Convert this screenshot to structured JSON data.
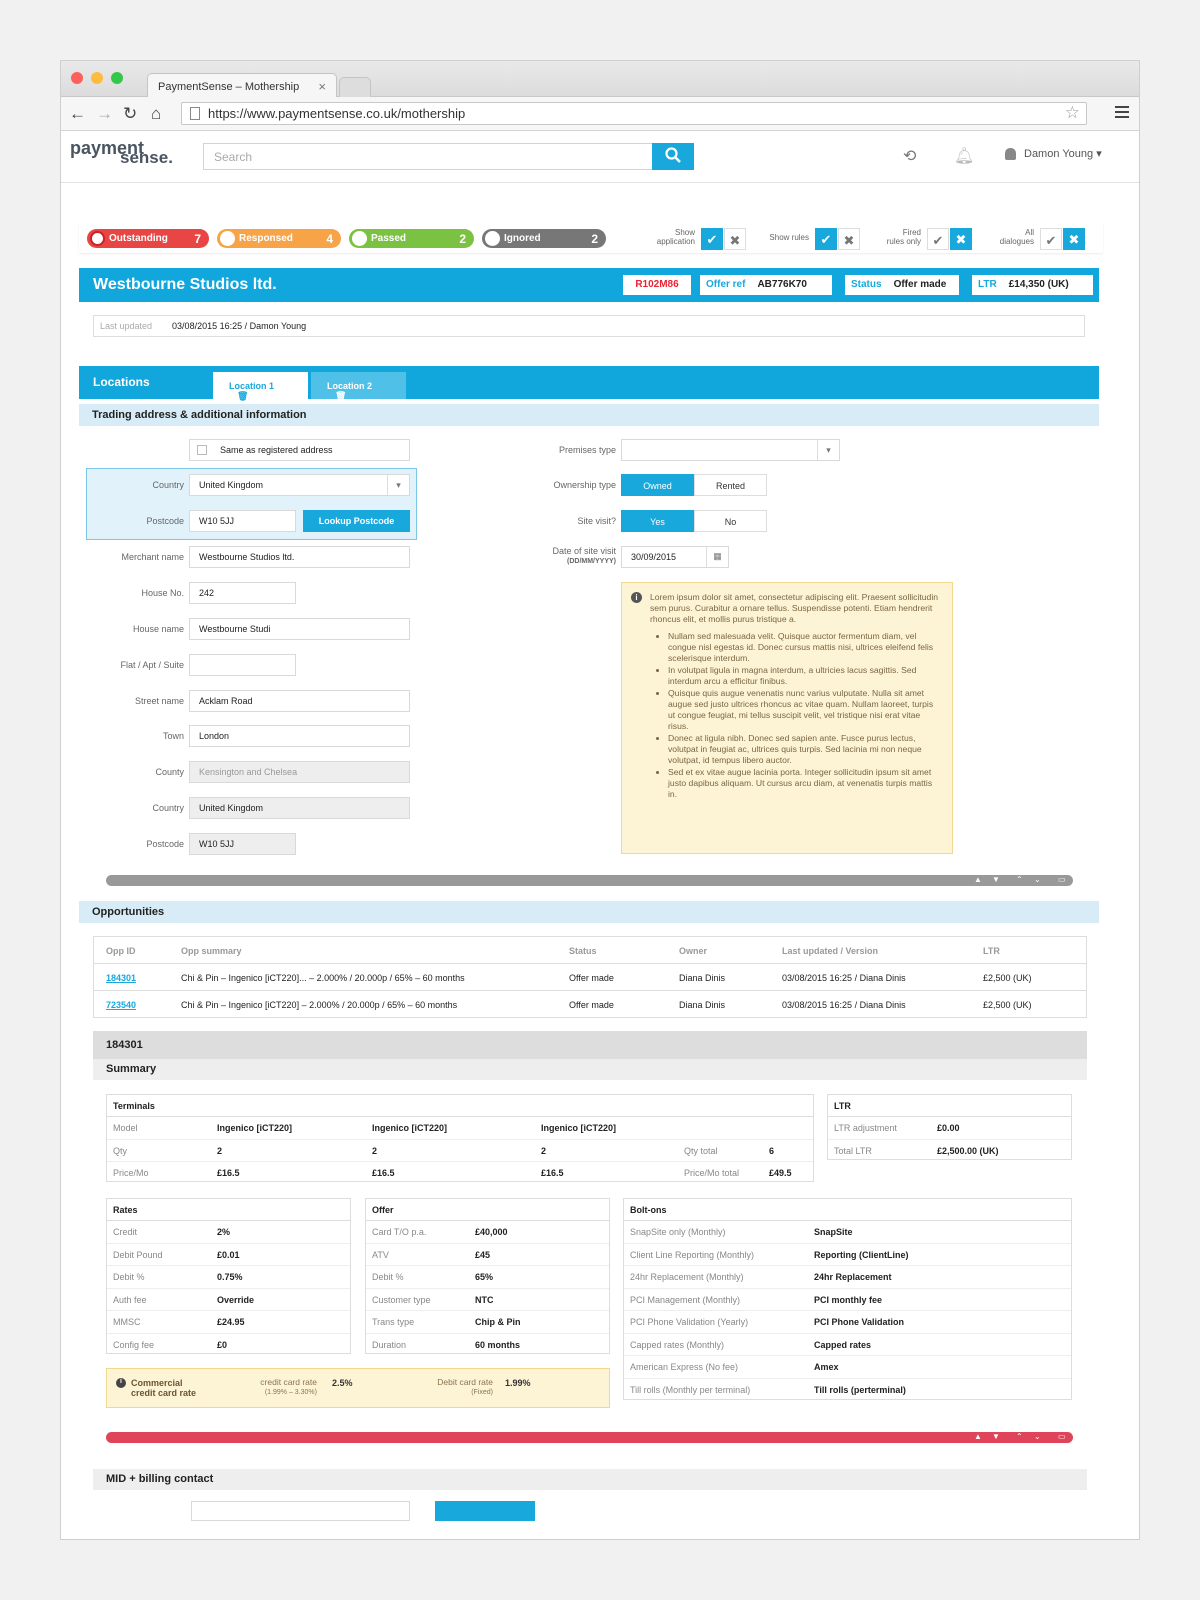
{
  "browser": {
    "tab_title": "PaymentSense – Mothership",
    "tab_close": "×",
    "url": "https://www.paymentsense.co.uk/mothership"
  },
  "app": {
    "logo_line1": "payment",
    "logo_line2": "sense.",
    "search_placeholder": "Search",
    "user_name": "Damon Young",
    "accent": "#18a8dc"
  },
  "filters": {
    "pills": [
      {
        "label": "Outstanding",
        "count": "7",
        "color": "#e84545"
      },
      {
        "label": "Responsed",
        "count": "4",
        "color": "#f7a448"
      },
      {
        "label": "Passed",
        "count": "2",
        "color": "#7cc242"
      },
      {
        "label": "Ignored",
        "count": "2",
        "color": "#777777"
      }
    ],
    "toggles": [
      {
        "label1": "Show",
        "label2": "application"
      },
      {
        "label1": "Show rules",
        "label2": ""
      },
      {
        "label1": "Fired",
        "label2": "rules only"
      },
      {
        "label1": "All",
        "label2": "dialogues"
      }
    ]
  },
  "merchant": {
    "name": "Westbourne Studios ltd.",
    "ref": "R102M86",
    "offer_ref_label": "Offer ref",
    "offer_ref": "AB776K70",
    "status_label": "Status",
    "status": "Offer made",
    "ltr_label": "LTR",
    "ltr": "£14,350 (UK)",
    "last_updated_label": "Last updated",
    "last_updated": "03/08/2015 16:25 / Damon Young"
  },
  "locations": {
    "title": "Locations",
    "tabs": [
      "Location 1",
      "Location 2"
    ],
    "section_title": "Trading address & additional information",
    "same_as_registered": "Same as registered address",
    "fields": {
      "country_label": "Country",
      "country": "United Kingdom",
      "postcode_label": "Postcode",
      "postcode": "W10 5JJ",
      "lookup": "Lookup Postcode",
      "merchant_label": "Merchant name",
      "merchant": "Westbourne Studios ltd.",
      "house_no_label": "House No.",
      "house_no": "242",
      "house_name_label": "House name",
      "house_name": "Westbourne Studi",
      "flat_label": "Flat / Apt / Suite",
      "flat": "",
      "street_label": "Street name",
      "street": "Acklam Road",
      "town_label": "Town",
      "town": "London",
      "county_label": "County",
      "county": "Kensington and Chelsea",
      "country2_label": "Country",
      "country2": "United Kingdom",
      "postcode2_label": "Postcode",
      "postcode2": "W10 5JJ"
    },
    "right": {
      "premises_label": "Premises type",
      "ownership_label": "Ownership type",
      "owned": "Owned",
      "rented": "Rented",
      "site_visit_label": "Site visit?",
      "yes": "Yes",
      "no": "No",
      "date_label": "Date of site visit",
      "date_hint": "(DD/MM/YYYY)",
      "date": "30/09/2015"
    },
    "info_intro": "Lorem ipsum dolor sit amet, consectetur adipiscing elit. Praesent sollicitudin sem purus. Curabitur a ornare tellus. Suspendisse potenti. Etiam hendrerit rhoncus elit, et mollis purus tristique a.",
    "info_items": [
      "Nullam sed malesuada velit. Quisque auctor fermentum diam, vel congue nisl egestas id. Donec cursus mattis nisi, ultrices eleifend felis scelerisque interdum.",
      "In volutpat ligula in magna interdum, a ultricies lacus sagittis. Sed interdum arcu a efficitur finibus.",
      "Quisque quis augue venenatis nunc varius vulputate. Nulla sit amet augue sed justo ultrices rhoncus ac vitae quam. Nullam laoreet, turpis ut congue feugiat, mi tellus suscipit velit, vel tristique nisi erat vitae risus.",
      "Donec at ligula nibh. Donec sed sapien ante. Fusce purus lectus, volutpat in feugiat ac, ultrices quis turpis. Sed lacinia mi non neque volutpat, id tempus libero auctor.",
      "Sed et ex vitae augue lacinia porta. Integer sollicitudin ipsum sit amet justo dapibus aliquam. Ut cursus arcu diam, at venenatis turpis mattis in."
    ]
  },
  "opportunities": {
    "title": "Opportunities",
    "headers": [
      "Opp ID",
      "Opp summary",
      "Status",
      "Owner",
      "Last updated / Version",
      "LTR"
    ],
    "rows": [
      [
        "184301",
        "Chi & Pin – Ingenico [iCT220]... – 2.000% / 20.000p / 65% – 60 months",
        "Offer made",
        "Diana Dinis",
        "03/08/2015 16:25 / Diana Dinis",
        "£2,500 (UK)"
      ],
      [
        "723540",
        "Chi & Pin – Ingenico [iCT220] – 2.000% / 20.000p / 65% – 60 months",
        "Offer made",
        "Diana Dinis",
        "03/08/2015 16:25 / Diana Dinis",
        "£2,500 (UK)"
      ]
    ]
  },
  "detail": {
    "id": "184301",
    "summary": "Summary",
    "terminals": {
      "title": "Terminals",
      "model_label": "Model",
      "models": [
        "Ingenico [iCT220]",
        "Ingenico [iCT220]",
        "Ingenico [iCT220]"
      ],
      "qty_label": "Qty",
      "qtys": [
        "2",
        "2",
        "2"
      ],
      "qty_total_label": "Qty total",
      "qty_total": "6",
      "price_label": "Price/Mo",
      "prices": [
        "£16.5",
        "£16.5",
        "£16.5"
      ],
      "price_total_label": "Price/Mo total",
      "price_total": "£49.5"
    },
    "ltr": {
      "title": "LTR",
      "rows": [
        [
          "LTR adjustment",
          "£0.00"
        ],
        [
          "Total LTR",
          "£2,500.00 (UK)"
        ]
      ]
    },
    "rates": {
      "title": "Rates",
      "rows": [
        [
          "Credit",
          "2%"
        ],
        [
          "Debit Pound",
          "£0.01"
        ],
        [
          "Debit %",
          "0.75%"
        ],
        [
          "Auth fee",
          "Override"
        ],
        [
          "MMSC",
          "£24.95"
        ],
        [
          "Config fee",
          "£0"
        ]
      ]
    },
    "offer": {
      "title": "Offer",
      "rows": [
        [
          "Card T/O p.a.",
          "£40,000"
        ],
        [
          "ATV",
          "£45"
        ],
        [
          "Debit %",
          "65%"
        ],
        [
          "Customer type",
          "NTC"
        ],
        [
          "Trans type",
          "Chip & Pin"
        ],
        [
          "Duration",
          "60 months"
        ]
      ]
    },
    "boltons": {
      "title": "Bolt-ons",
      "rows": [
        [
          "SnapSite only (Monthly)",
          "SnapSite"
        ],
        [
          "Client Line Reporting (Monthly)",
          "Reporting (ClientLine)"
        ],
        [
          "24hr Replacement (Monthly)",
          "24hr Replacement"
        ],
        [
          "PCI Management (Monthly)",
          "PCI monthly fee"
        ],
        [
          "PCI Phone Validation (Yearly)",
          "PCI Phone Validation"
        ],
        [
          "Capped rates (Monthly)",
          "Capped rates"
        ],
        [
          "American Express (No fee)",
          "Amex"
        ],
        [
          "Till rolls (Monthly per terminal)",
          "Till rolls (perterminal)"
        ]
      ]
    },
    "commercial": {
      "title1": "Commercial",
      "title2": "credit card rate",
      "cc_label": "credit card rate",
      "cc_sub": "(1.99% – 3.30%)",
      "cc_value": "2.5%",
      "debit_label": "Debit card rate",
      "debit_sub": "(Fixed)",
      "debit_value": "1.99%"
    },
    "mid_title": "MID + billing contact"
  }
}
